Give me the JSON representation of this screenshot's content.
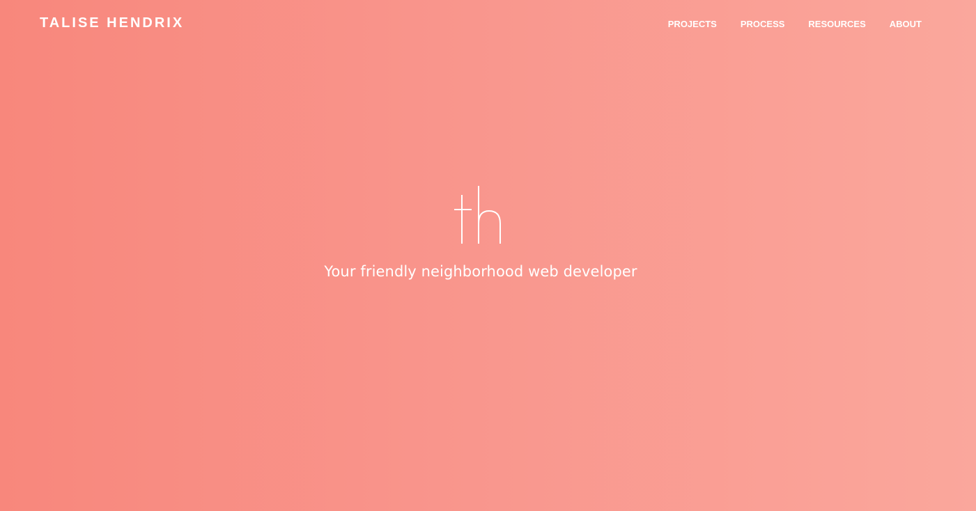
{
  "header": {
    "brand": "TALISE HENDRIX",
    "nav": [
      {
        "label": "PROJECTS"
      },
      {
        "label": "PROCESS"
      },
      {
        "label": "RESOURCES"
      },
      {
        "label": "ABOUT"
      }
    ]
  },
  "hero": {
    "logo_text": "th",
    "tagline": "Your friendly neighborhood web developer"
  },
  "theme": {
    "gradient_start": "#f8877c",
    "gradient_end": "#faa79c",
    "text_color": "#ffffff"
  }
}
